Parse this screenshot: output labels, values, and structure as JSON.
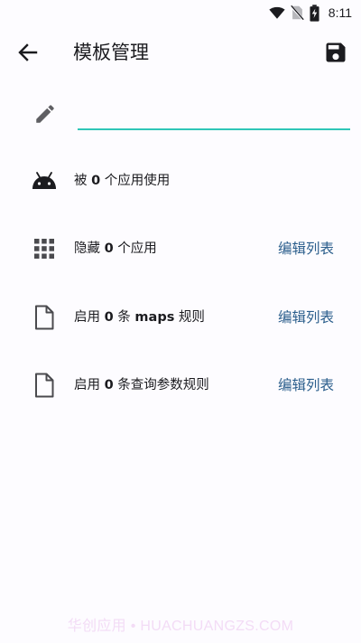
{
  "status_bar": {
    "time": "8:11",
    "icons": [
      "wifi-icon",
      "no-sim-icon",
      "battery-charging-icon"
    ]
  },
  "app_bar": {
    "title": "模板管理",
    "back_icon": "arrow-back-icon",
    "save_icon": "save-icon"
  },
  "name_field": {
    "value": "",
    "icon": "pencil-icon",
    "accent_color": "#2fc6b8"
  },
  "rows": [
    {
      "icon": "android-icon",
      "prefix": "被 ",
      "count": "0",
      "suffix": " 个应用使用",
      "action": ""
    },
    {
      "icon": "apps-grid-icon",
      "prefix": "隐藏 ",
      "count": "0",
      "suffix": " 个应用",
      "action": "编辑列表"
    },
    {
      "icon": "file-icon",
      "prefix": "启用 ",
      "count": "0",
      "suffix": " 条 ",
      "bold_extra": "maps",
      "suffix2": " 规则",
      "action": "编辑列表"
    },
    {
      "icon": "file-icon",
      "prefix": "启用 ",
      "count": "0",
      "suffix": " 条查询参数规则",
      "action": "编辑列表"
    }
  ],
  "colors": {
    "action_text": "#2b5e8c",
    "background": "#fdfcff"
  },
  "watermark": "华创应用 • HUACHUANGZS.COM"
}
